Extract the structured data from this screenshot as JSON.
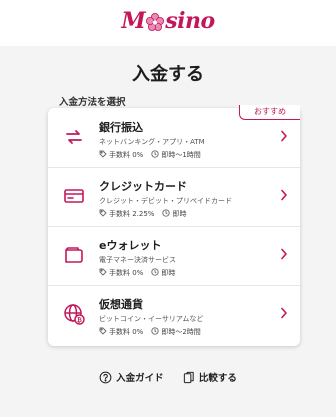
{
  "brand": {
    "logo_text_left": "M",
    "logo_text_right": "sino",
    "accent": "#c2185b"
  },
  "page": {
    "title": "入金する",
    "section_label": "入金方法を選択"
  },
  "badge": "おすすめ",
  "methods": [
    {
      "name": "銀行振込",
      "desc": "ネットバンキング・アプリ・ATM",
      "fee": "手数料 0%",
      "speed": "即時〜1時間",
      "icon": "transfer-icon"
    },
    {
      "name": "クレジットカード",
      "desc": "クレジット・デビット・プリペイドカード",
      "fee": "手数料 2.25%",
      "speed": "即時",
      "icon": "credit-card-icon"
    },
    {
      "name": "eウォレット",
      "desc": "電子マネー決済サービス",
      "fee": "手数料 0%",
      "speed": "即時",
      "icon": "wallet-icon"
    },
    {
      "name": "仮想通貨",
      "desc": "ビットコイン・イーサリアムなど",
      "fee": "手数料 0%",
      "speed": "即時〜2時間",
      "icon": "crypto-globe-icon"
    }
  ],
  "footer": {
    "guide": "入金ガイド",
    "compare": "比較する"
  }
}
